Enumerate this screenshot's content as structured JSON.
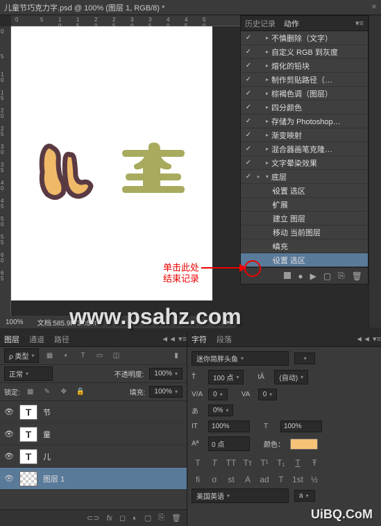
{
  "titlebar": {
    "text": "儿童节巧克力字.psd @ 100% (图层 1, RGB/8) *"
  },
  "history": {
    "tabs": {
      "history": "历史记录",
      "actions": "动作"
    },
    "items": [
      {
        "check": "✓",
        "dot": "",
        "arrow": "▸",
        "txt": "不慎删除（文字）",
        "indent": 0
      },
      {
        "check": "✓",
        "dot": "",
        "arrow": "▸",
        "txt": "自定义 RGB 到灰度",
        "indent": 0
      },
      {
        "check": "✓",
        "dot": "",
        "arrow": "▸",
        "txt": "熔化的铅块",
        "indent": 0
      },
      {
        "check": "✓",
        "dot": "",
        "arrow": "▸",
        "txt": "制作剪贴路径（…",
        "indent": 0
      },
      {
        "check": "✓",
        "dot": "",
        "arrow": "▸",
        "txt": "棕褐色调（图层）",
        "indent": 0
      },
      {
        "check": "✓",
        "dot": "",
        "arrow": "▸",
        "txt": "四分颜色",
        "indent": 0
      },
      {
        "check": "✓",
        "dot": "",
        "arrow": "▸",
        "txt": "存储为 Photoshop…",
        "indent": 0
      },
      {
        "check": "✓",
        "dot": "",
        "arrow": "▸",
        "txt": "渐变映射",
        "indent": 0
      },
      {
        "check": "✓",
        "dot": "",
        "arrow": "▸",
        "txt": "混合器画笔克隆…",
        "indent": 0
      },
      {
        "check": "✓",
        "dot": "",
        "arrow": "▸",
        "txt": "文字晕染效果",
        "indent": 0
      },
      {
        "check": "✓",
        "dot": "●",
        "arrow": "▾",
        "txt": "底层",
        "indent": 0
      },
      {
        "check": "",
        "dot": "",
        "arrow": "▸",
        "txt": "设置 选区",
        "indent": 1
      },
      {
        "check": "",
        "dot": "",
        "arrow": "▸",
        "txt": "扩展",
        "indent": 1
      },
      {
        "check": "",
        "dot": "",
        "arrow": "",
        "txt": "建立 图层",
        "indent": 1
      },
      {
        "check": "",
        "dot": "",
        "arrow": "",
        "txt": "移动 当前图层",
        "indent": 1
      },
      {
        "check": "",
        "dot": "",
        "arrow": "▸",
        "txt": "填充",
        "indent": 1
      },
      {
        "check": "",
        "dot": "",
        "arrow": "▸",
        "txt": "设置 选区",
        "indent": 1,
        "sel": true
      }
    ]
  },
  "annotation": {
    "line1": "单击此处",
    "line2": "结束记录"
  },
  "status": {
    "zoom": "100%",
    "doc": "文档:585.9K/3.05M"
  },
  "watermark": {
    "main": "www.psahz.com",
    "corner": "UiBQ.CoM"
  },
  "layers": {
    "tabs": {
      "layers": "图层",
      "channels": "通道",
      "paths": "路径"
    },
    "filter_label": "ρ 类型",
    "blend": "正常",
    "opacity_label": "不透明度:",
    "opacity": "100%",
    "lock_label": "锁定:",
    "fill_label": "填充:",
    "fill": "100%",
    "items": [
      {
        "thumb": "T",
        "name": "节"
      },
      {
        "thumb": "T",
        "name": "童"
      },
      {
        "thumb": "T",
        "name": "儿"
      },
      {
        "thumb": "",
        "name": "图层 1",
        "sel": true,
        "checker": true
      }
    ]
  },
  "character": {
    "tabs": {
      "char": "字符",
      "para": "段落"
    },
    "font": "迷你简胖头鱼",
    "size": "100 点",
    "leading": "(自动)",
    "va": "0",
    "va2": "0",
    "baseline": "0%",
    "hscale": "100%",
    "vscale": "100%",
    "aa": "0 点",
    "color_label": "颜色：",
    "lang": "美国英语",
    "t_label": "T",
    "tt_label": "tT",
    "it_label": "IT",
    "st_label": "T"
  }
}
